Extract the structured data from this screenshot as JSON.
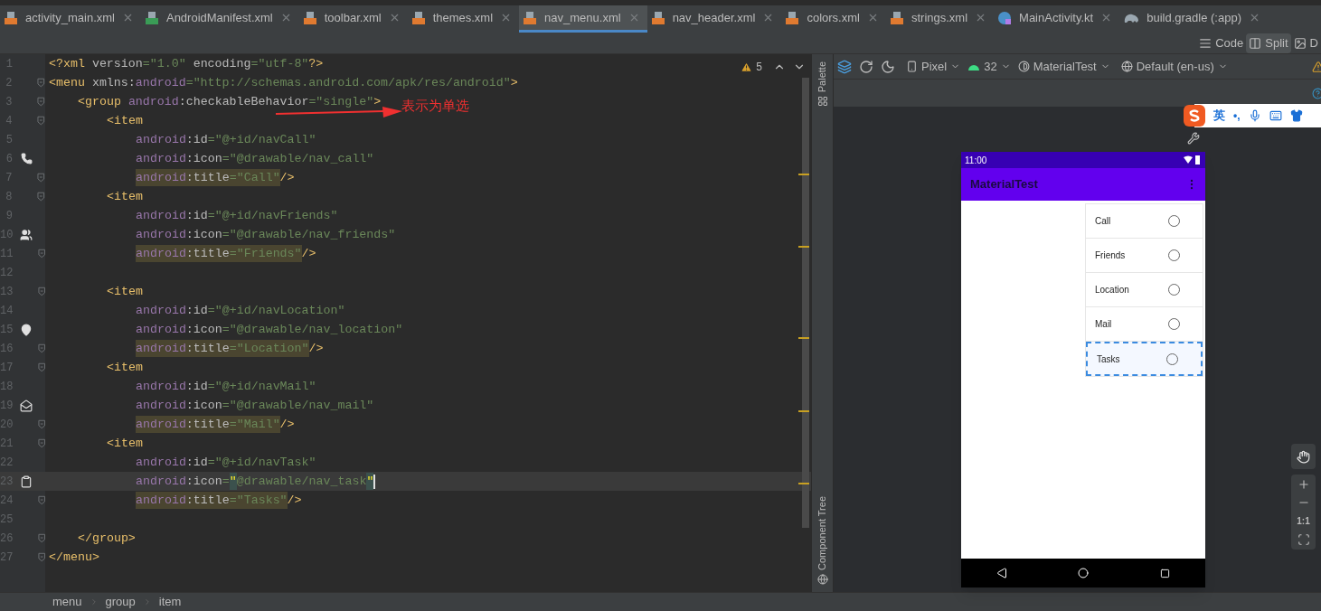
{
  "tabs": [
    {
      "label": "activity_main.xml",
      "kind": "xml",
      "selected": false
    },
    {
      "label": "AndroidManifest.xml",
      "kind": "manifest",
      "selected": false
    },
    {
      "label": "toolbar.xml",
      "kind": "xml",
      "selected": false
    },
    {
      "label": "themes.xml",
      "kind": "xml",
      "selected": false
    },
    {
      "label": "nav_menu.xml",
      "kind": "xml",
      "selected": true
    },
    {
      "label": "nav_header.xml",
      "kind": "xml",
      "selected": false
    },
    {
      "label": "colors.xml",
      "kind": "xml",
      "selected": false
    },
    {
      "label": "strings.xml",
      "kind": "xml",
      "selected": false
    },
    {
      "label": "MainActivity.kt",
      "kind": "kotlin",
      "selected": false
    },
    {
      "label": "build.gradle (:app)",
      "kind": "gradle",
      "selected": false
    }
  ],
  "view_modes": [
    {
      "label": "Code",
      "kind": "code",
      "selected": false
    },
    {
      "label": "Split",
      "kind": "split",
      "selected": true
    },
    {
      "label": "D",
      "kind": "design",
      "selected": false
    }
  ],
  "inspection": {
    "count": "5"
  },
  "editor": {
    "lines": [
      {
        "number": "1",
        "fold": false,
        "selected": false,
        "highlighted": false,
        "caret": false,
        "tokens": [
          {
            "kind": "tag",
            "text": "<?xml"
          },
          {
            "kind": "attr",
            "text": "version"
          },
          {
            "kind": "str",
            "text": "=\"1.0\""
          },
          {
            "kind": "attr",
            "text": "encoding"
          },
          {
            "kind": "str",
            "text": "=\"utf-8\""
          },
          {
            "kind": "tag",
            "text": "?>"
          }
        ]
      },
      {
        "number": "2",
        "fold": true,
        "selected": false,
        "highlighted": false,
        "caret": false,
        "tokens": [
          {
            "kind": "tag",
            "text": "<menu"
          },
          {
            "kind": "attr",
            "text": "xmlns:"
          },
          {
            "kind": "ns",
            "text": "android"
          },
          {
            "kind": "str",
            "text": "=\"http://schemas.android.com/apk/res/android\""
          },
          {
            "kind": "tag",
            "text": ">"
          }
        ]
      },
      {
        "number": "3",
        "fold": true,
        "selected": false,
        "highlighted": false,
        "caret": false,
        "tokens": [
          {
            "kind": "tag",
            "text": "<group"
          },
          {
            "kind": "ns",
            "text": "android"
          },
          {
            "kind": "attr",
            "text": ":checkableBehavior"
          },
          {
            "kind": "str",
            "text": "=\"single\""
          },
          {
            "kind": "tag",
            "text": ">"
          }
        ]
      },
      {
        "number": "4",
        "fold": true,
        "selected": false,
        "highlighted": false,
        "caret": false,
        "tokens": [
          {
            "kind": "tag",
            "text": "<item"
          }
        ]
      },
      {
        "number": "5",
        "fold": false,
        "selected": false,
        "highlighted": false,
        "caret": false,
        "tokens": [
          {
            "kind": "ns",
            "text": "android"
          },
          {
            "kind": "attr",
            "text": ":id"
          },
          {
            "kind": "str",
            "text": "=\"@+id/navCall\""
          }
        ]
      },
      {
        "number": "6",
        "fold": false,
        "selected": false,
        "highlighted": false,
        "caret": false,
        "gutter": {
          "kind": "phone"
        },
        "tokens": [
          {
            "kind": "ns",
            "text": "android"
          },
          {
            "kind": "attr",
            "text": ":icon"
          },
          {
            "kind": "str",
            "text": "=\"@drawable/nav_call\""
          }
        ]
      },
      {
        "number": "7",
        "fold": true,
        "selected": false,
        "highlighted": true,
        "caret": false,
        "tokens": [
          {
            "kind": "ns",
            "text": "android"
          },
          {
            "kind": "attr",
            "text": ":title"
          },
          {
            "kind": "str",
            "text": "=\"Call\""
          },
          {
            "kind": "close",
            "text": "/>"
          }
        ]
      },
      {
        "number": "8",
        "fold": true,
        "selected": false,
        "highlighted": false,
        "caret": false,
        "tokens": [
          {
            "kind": "tag",
            "text": "<item"
          }
        ]
      },
      {
        "number": "9",
        "fold": false,
        "selected": false,
        "highlighted": false,
        "caret": false,
        "tokens": [
          {
            "kind": "ns",
            "text": "android"
          },
          {
            "kind": "attr",
            "text": ":id"
          },
          {
            "kind": "str",
            "text": "=\"@+id/navFriends\""
          }
        ]
      },
      {
        "number": "10",
        "fold": false,
        "selected": false,
        "highlighted": false,
        "caret": false,
        "gutter": {
          "kind": "people"
        },
        "tokens": [
          {
            "kind": "ns",
            "text": "android"
          },
          {
            "kind": "attr",
            "text": ":icon"
          },
          {
            "kind": "str",
            "text": "=\"@drawable/nav_friends\""
          }
        ]
      },
      {
        "number": "11",
        "fold": true,
        "selected": false,
        "highlighted": true,
        "caret": false,
        "tokens": [
          {
            "kind": "ns",
            "text": "android"
          },
          {
            "kind": "attr",
            "text": ":title"
          },
          {
            "kind": "str",
            "text": "=\"Friends\""
          },
          {
            "kind": "close",
            "text": "/>"
          }
        ]
      },
      {
        "number": "12",
        "fold": false,
        "selected": false,
        "highlighted": false,
        "caret": false
      },
      {
        "number": "13",
        "fold": true,
        "selected": false,
        "highlighted": false,
        "caret": false,
        "tokens": [
          {
            "kind": "tag",
            "text": "<item"
          }
        ]
      },
      {
        "number": "14",
        "fold": false,
        "selected": false,
        "highlighted": false,
        "caret": false,
        "tokens": [
          {
            "kind": "ns",
            "text": "android"
          },
          {
            "kind": "attr",
            "text": ":id"
          },
          {
            "kind": "str",
            "text": "=\"@+id/navLocation\""
          }
        ]
      },
      {
        "number": "15",
        "fold": false,
        "selected": false,
        "highlighted": false,
        "caret": false,
        "gutter": {
          "kind": "pin"
        },
        "tokens": [
          {
            "kind": "ns",
            "text": "android"
          },
          {
            "kind": "attr",
            "text": ":icon"
          },
          {
            "kind": "str",
            "text": "=\"@drawable/nav_location\""
          }
        ]
      },
      {
        "number": "16",
        "fold": true,
        "selected": false,
        "highlighted": true,
        "caret": false,
        "tokens": [
          {
            "kind": "ns",
            "text": "android"
          },
          {
            "kind": "attr",
            "text": ":title"
          },
          {
            "kind": "str",
            "text": "=\"Location\""
          },
          {
            "kind": "close",
            "text": "/>"
          }
        ]
      },
      {
        "number": "17",
        "fold": true,
        "selected": false,
        "highlighted": false,
        "caret": false,
        "tokens": [
          {
            "kind": "tag",
            "text": "<item"
          }
        ]
      },
      {
        "number": "18",
        "fold": false,
        "selected": false,
        "highlighted": false,
        "caret": false,
        "tokens": [
          {
            "kind": "ns",
            "text": "android"
          },
          {
            "kind": "attr",
            "text": ":id"
          },
          {
            "kind": "str",
            "text": "=\"@+id/navMail\""
          }
        ]
      },
      {
        "number": "19",
        "fold": false,
        "selected": false,
        "highlighted": false,
        "caret": false,
        "gutter": {
          "kind": "mail"
        },
        "tokens": [
          {
            "kind": "ns",
            "text": "android"
          },
          {
            "kind": "attr",
            "text": ":icon"
          },
          {
            "kind": "str",
            "text": "=\"@drawable/nav_mail\""
          }
        ]
      },
      {
        "number": "20",
        "fold": true,
        "selected": false,
        "highlighted": true,
        "caret": false,
        "tokens": [
          {
            "kind": "ns",
            "text": "android"
          },
          {
            "kind": "attr",
            "text": ":title"
          },
          {
            "kind": "str",
            "text": "=\"Mail\""
          },
          {
            "kind": "close",
            "text": "/>"
          }
        ]
      },
      {
        "number": "21",
        "fold": true,
        "selected": false,
        "highlighted": false,
        "caret": false,
        "tokens": [
          {
            "kind": "tag",
            "text": "<item"
          }
        ]
      },
      {
        "number": "22",
        "fold": false,
        "selected": false,
        "highlighted": false,
        "caret": false,
        "tokens": [
          {
            "kind": "ns",
            "text": "android"
          },
          {
            "kind": "attr",
            "text": ":id"
          },
          {
            "kind": "str",
            "text": "=\"@+id/navTask\""
          }
        ]
      },
      {
        "number": "23",
        "fold": false,
        "selected": true,
        "highlighted": false,
        "caret": true,
        "gutter": {
          "kind": "clipboard"
        },
        "tokens": [
          {
            "kind": "ns",
            "text": "android"
          },
          {
            "kind": "attr",
            "text": ":icon"
          },
          {
            "kind": "str",
            "text": "="
          },
          {
            "kind": "match",
            "text": "\""
          },
          {
            "kind": "str",
            "text": "@drawable/nav_task"
          },
          {
            "kind": "match",
            "text": "\""
          }
        ]
      },
      {
        "number": "24",
        "fold": true,
        "selected": false,
        "highlighted": true,
        "caret": false,
        "tokens": [
          {
            "kind": "ns",
            "text": "android"
          },
          {
            "kind": "attr",
            "text": ":title"
          },
          {
            "kind": "str",
            "text": "=\"Tasks\""
          },
          {
            "kind": "close",
            "text": "/>"
          }
        ]
      },
      {
        "number": "25",
        "fold": false,
        "selected": false,
        "highlighted": false,
        "caret": false
      },
      {
        "number": "26",
        "fold": true,
        "selected": false,
        "highlighted": false,
        "caret": false,
        "tokens": [
          {
            "kind": "tag",
            "text": "</group>"
          }
        ]
      },
      {
        "number": "27",
        "fold": true,
        "selected": false,
        "highlighted": false,
        "caret": false,
        "tokens": [
          {
            "kind": "tag",
            "text": "</menu>"
          }
        ]
      }
    ],
    "annotation": "表示为单选"
  },
  "breadcrumbs": [
    "menu",
    "group",
    "item"
  ],
  "side_tabs": {
    "top": "Palette",
    "bottom": "Component Tree"
  },
  "design_toolbar": {
    "device": "Pixel",
    "api": "32",
    "theme": "MaterialTest",
    "locale": "Default (en-us)"
  },
  "ime_bar": {
    "mode": "英",
    "punct": "•,"
  },
  "phone": {
    "time": "11:00",
    "app_title": "MaterialTest",
    "menu_items": [
      {
        "label": "Call",
        "selected": false
      },
      {
        "label": "Friends",
        "selected": false
      },
      {
        "label": "Location",
        "selected": false
      },
      {
        "label": "Mail",
        "selected": false
      },
      {
        "label": "Tasks",
        "selected": true
      }
    ]
  },
  "zoom_controls": {
    "actual_size": "1:1"
  }
}
